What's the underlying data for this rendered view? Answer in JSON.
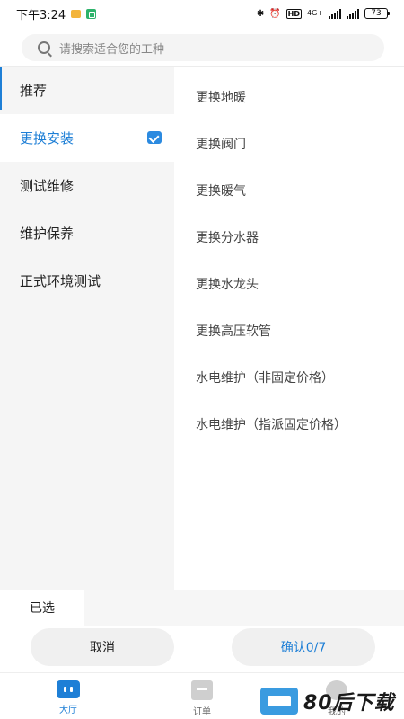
{
  "status_bar": {
    "time": "下午3:24",
    "network": "4G+",
    "hd": "HD",
    "battery": "73"
  },
  "search": {
    "placeholder": "请搜索适合您的工种"
  },
  "categories": [
    {
      "label": "推荐",
      "active": false
    },
    {
      "label": "更换安装",
      "active": true,
      "checked": true
    },
    {
      "label": "测试维修",
      "active": false
    },
    {
      "label": "维护保养",
      "active": false
    },
    {
      "label": "正式环境测试",
      "active": false
    }
  ],
  "sub_items": [
    "更换地暖",
    "更换阀门",
    "更换暖气",
    "更换分水器",
    "更换水龙头",
    "更换高压软管",
    "水电维护（非固定价格）",
    "水电维护（指派固定价格）"
  ],
  "bottom": {
    "selected_label": "已选",
    "cancel_label": "取消",
    "confirm_label": "确认0/7"
  },
  "tabs": [
    {
      "label": "大厅",
      "icon": "home-icon",
      "active": true
    },
    {
      "label": "订单",
      "icon": "clipboard-icon",
      "active": false
    },
    {
      "label": "我的",
      "icon": "person-icon",
      "active": false
    }
  ],
  "watermark": {
    "text": "80后下载"
  },
  "colors": {
    "accent": "#1e7fd6",
    "panel": "#f5f5f5"
  }
}
